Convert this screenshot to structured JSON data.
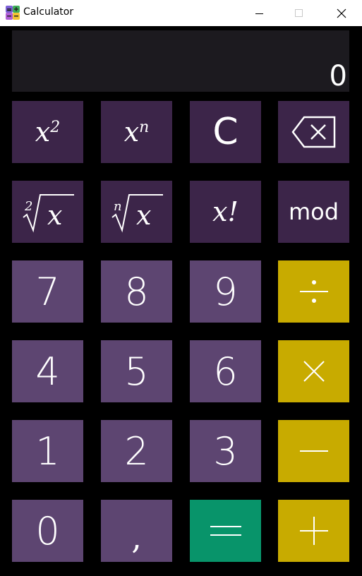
{
  "window": {
    "title": "Calculator",
    "controls": [
      "minimize-icon",
      "maximize-icon",
      "close-icon"
    ]
  },
  "display": {
    "value": "0"
  },
  "keys": {
    "square": {
      "base": "x",
      "exp": "2"
    },
    "power": {
      "base": "x",
      "exp": "n"
    },
    "clear": "C",
    "backspace": "backspace-icon",
    "sqrt": {
      "index": "2",
      "radicand": "x"
    },
    "nth_root": {
      "index": "n",
      "radicand": "x"
    },
    "factorial": "x!",
    "mod": "mod",
    "d7": "7",
    "d8": "8",
    "d9": "9",
    "divide": "divide-icon",
    "d4": "4",
    "d5": "5",
    "d6": "6",
    "multiply": "multiply-icon",
    "d1": "1",
    "d2": "2",
    "d3": "3",
    "subtract": "minus-icon",
    "d0": "0",
    "comma": ",",
    "equals": "equals-icon",
    "add": "plus-icon"
  },
  "colors": {
    "function_key": "#3c2549",
    "digit_key": "#5d4571",
    "operator_key": "#c8ab00",
    "equals_key": "#08946a",
    "display_bg": "#1c1a1f",
    "background": "#000000"
  }
}
